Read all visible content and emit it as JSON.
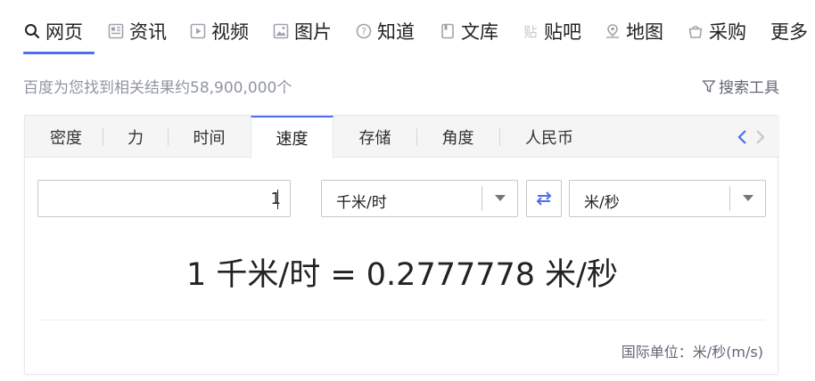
{
  "nav": {
    "items": [
      {
        "label": "网页",
        "icon": "search-icon",
        "active": true
      },
      {
        "label": "资讯",
        "icon": "news-icon"
      },
      {
        "label": "视频",
        "icon": "video-icon"
      },
      {
        "label": "图片",
        "icon": "image-icon"
      },
      {
        "label": "知道",
        "icon": "question-icon"
      },
      {
        "label": "文库",
        "icon": "document-icon"
      },
      {
        "label": "贴吧",
        "icon": "tieba-icon"
      },
      {
        "label": "地图",
        "icon": "map-icon"
      },
      {
        "label": "采购",
        "icon": "basket-icon"
      },
      {
        "label": "更多"
      }
    ]
  },
  "result_count": {
    "prefix": "百度为您找到相关结果约",
    "number": "58,900,000",
    "suffix": "个"
  },
  "search_tools": "搜索工具",
  "converter": {
    "tabs": [
      "密度",
      "力",
      "时间",
      "速度",
      "存储",
      "角度",
      "人民币"
    ],
    "active_tab": "速度",
    "input_value": "1",
    "from_unit": "千米/时",
    "to_unit": "米/秒",
    "result_text": "1 千米/时 = 0.2777778 米/秒",
    "unit_note": "国际单位：米/秒(m/s)"
  },
  "colors": {
    "accent": "#4e6ef2",
    "muted": "#9195a3",
    "border": "#c4c7ce"
  }
}
